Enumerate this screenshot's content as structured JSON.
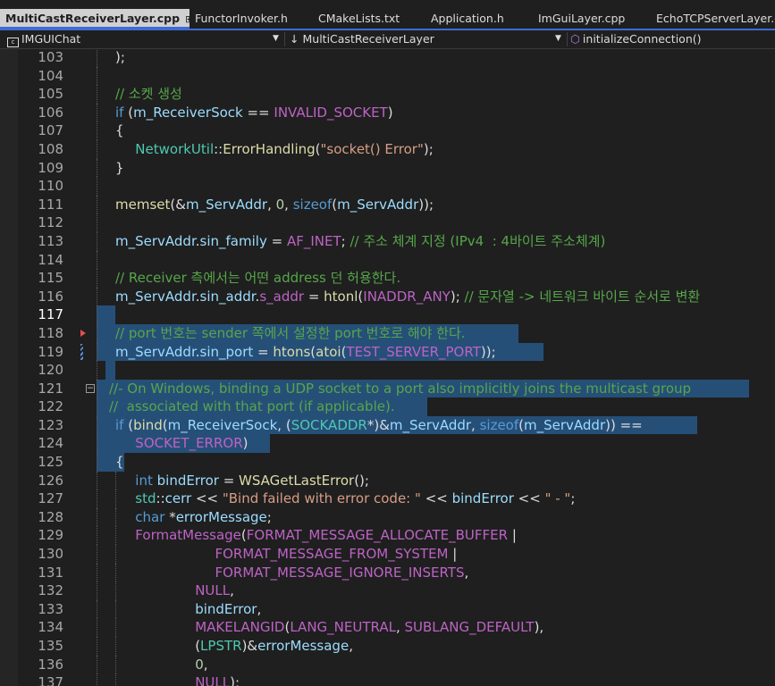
{
  "tabs": [
    {
      "label": "MultiCastReceiverLayer.cpp",
      "active": true,
      "pinned": true,
      "closable": true
    },
    {
      "label": "FunctorInvoker.h"
    },
    {
      "label": "CMakeLists.txt"
    },
    {
      "label": "Application.h"
    },
    {
      "label": "ImGuiLayer.cpp"
    },
    {
      "label": "EchoTCPServerLayer.cpp"
    }
  ],
  "navbar": {
    "project": "IMGUIChat",
    "scope": "MultiCastReceiverLayer",
    "member": "initializeConnection()"
  },
  "colors": {
    "background": "#1f1f1f",
    "selection": "#264f78",
    "keyword": "#569cd6",
    "comment": "#57a64a",
    "string": "#d69d85",
    "type": "#4ec9b0",
    "macro": "#bd63c5",
    "function": "#dcdcaa",
    "number": "#b5cea8",
    "active_tab": "#d0d0d0",
    "tab_accent": "#3e6bd6"
  },
  "editor": {
    "current_line": 117,
    "lines": [
      {
        "n": "103",
        "ind": 0,
        "toks": [
          [
            "pl",
            ");"
          ]
        ]
      },
      {
        "n": "104",
        "ind": 0,
        "toks": []
      },
      {
        "n": "105",
        "ind": 0,
        "toks": [
          [
            "cm",
            "// 소켓 생성"
          ]
        ]
      },
      {
        "n": "106",
        "ind": 0,
        "toks": [
          [
            "kw",
            "if"
          ],
          [
            "pl",
            " ("
          ],
          [
            "var",
            "m_ReceiverSock"
          ],
          [
            "pl",
            " == "
          ],
          [
            "mac",
            "INVALID_SOCKET"
          ],
          [
            "pl",
            ")"
          ]
        ]
      },
      {
        "n": "107",
        "ind": 0,
        "toks": [
          [
            "pl",
            "{"
          ]
        ]
      },
      {
        "n": "108",
        "ind": 1,
        "toks": [
          [
            "ty",
            "NetworkUtil"
          ],
          [
            "pl",
            "::"
          ],
          [
            "fn",
            "ErrorHandling"
          ],
          [
            "pl",
            "("
          ],
          [
            "str",
            "\"socket() Error\""
          ],
          [
            "pl",
            ");"
          ]
        ]
      },
      {
        "n": "109",
        "ind": 0,
        "toks": [
          [
            "pl",
            "}"
          ]
        ]
      },
      {
        "n": "110",
        "ind": 0,
        "toks": []
      },
      {
        "n": "111",
        "ind": 0,
        "toks": [
          [
            "fn",
            "memset"
          ],
          [
            "pl",
            "(&"
          ],
          [
            "var",
            "m_ServAddr"
          ],
          [
            "pl",
            ", "
          ],
          [
            "num",
            "0"
          ],
          [
            "pl",
            ", "
          ],
          [
            "kw",
            "sizeof"
          ],
          [
            "pl",
            "("
          ],
          [
            "var",
            "m_ServAddr"
          ],
          [
            "pl",
            "));"
          ]
        ]
      },
      {
        "n": "112",
        "ind": 0,
        "toks": []
      },
      {
        "n": "113",
        "ind": 0,
        "toks": [
          [
            "var",
            "m_ServAddr"
          ],
          [
            "pl",
            "."
          ],
          [
            "var",
            "sin_family"
          ],
          [
            "pl",
            " = "
          ],
          [
            "mac",
            "AF_INET"
          ],
          [
            "pl",
            "; "
          ],
          [
            "cm",
            "// 주소 체계 지정 (IPv4  : 4바이트 주소체계)"
          ]
        ]
      },
      {
        "n": "114",
        "ind": 0,
        "toks": []
      },
      {
        "n": "115",
        "ind": 0,
        "toks": [
          [
            "cm",
            "// Receiver 측에서는 어떤 address 던 허용한다."
          ]
        ]
      },
      {
        "n": "116",
        "ind": 0,
        "toks": [
          [
            "var",
            "m_ServAddr"
          ],
          [
            "pl",
            "."
          ],
          [
            "var",
            "sin_addr"
          ],
          [
            "pl",
            "."
          ],
          [
            "mac",
            "s_addr"
          ],
          [
            "pl",
            " = "
          ],
          [
            "fn",
            "htonl"
          ],
          [
            "pl",
            "("
          ],
          [
            "mac",
            "INADDR_ANY"
          ],
          [
            "pl",
            "); "
          ],
          [
            "cm",
            "// 문자열 -> 네트워크 바이트 순서로 변환"
          ]
        ]
      },
      {
        "n": "117",
        "ind": 0,
        "toks": []
      },
      {
        "n": "118",
        "ind": 0,
        "toks": [
          [
            "cm",
            "// port 번호는 sender 쪽에서 설정한 port 번호로 해야 한다."
          ]
        ]
      },
      {
        "n": "119",
        "ind": 0,
        "toks": [
          [
            "var",
            "m_ServAddr"
          ],
          [
            "pl",
            "."
          ],
          [
            "var",
            "sin_port"
          ],
          [
            "pl",
            " = "
          ],
          [
            "fn",
            "htons"
          ],
          [
            "pl",
            "("
          ],
          [
            "fn",
            "atoi"
          ],
          [
            "pl",
            "("
          ],
          [
            "mac",
            "TEST_SERVER_PORT"
          ],
          [
            "pl",
            "));"
          ]
        ]
      },
      {
        "n": "120",
        "ind": 0,
        "toks": []
      },
      {
        "n": "121",
        "ind": 0,
        "toks": [
          [
            "cm",
            "//- On Windows, binding a UDP socket to a port also implicitly joins the multicast group"
          ]
        ]
      },
      {
        "n": "122",
        "ind": 0,
        "toks": [
          [
            "cm",
            "//  associated with that port (if applicable)."
          ]
        ]
      },
      {
        "n": "123",
        "ind": 0,
        "toks": [
          [
            "kw",
            "if"
          ],
          [
            "pl",
            " ("
          ],
          [
            "fn",
            "bind"
          ],
          [
            "pl",
            "("
          ],
          [
            "var",
            "m_ReceiverSock"
          ],
          [
            "pl",
            ", ("
          ],
          [
            "ty",
            "SOCKADDR"
          ],
          [
            "pl",
            "*)&"
          ],
          [
            "var",
            "m_ServAddr"
          ],
          [
            "pl",
            ", "
          ],
          [
            "kw",
            "sizeof"
          ],
          [
            "pl",
            "("
          ],
          [
            "var",
            "m_ServAddr"
          ],
          [
            "pl",
            ")) =="
          ]
        ]
      },
      {
        "n": "124",
        "ind": 1,
        "toks": [
          [
            "mac",
            "SOCKET_ERROR"
          ],
          [
            "pl",
            ")"
          ]
        ]
      },
      {
        "n": "125",
        "ind": 0,
        "toks": [
          [
            "pl",
            "{"
          ]
        ]
      },
      {
        "n": "126",
        "ind": 1,
        "toks": [
          [
            "kw",
            "int"
          ],
          [
            "pl",
            " "
          ],
          [
            "var",
            "bindError"
          ],
          [
            "pl",
            " = "
          ],
          [
            "fn",
            "WSAGetLastError"
          ],
          [
            "pl",
            "();"
          ]
        ]
      },
      {
        "n": "127",
        "ind": 1,
        "toks": [
          [
            "ty",
            "std"
          ],
          [
            "pl",
            "::"
          ],
          [
            "var",
            "cerr"
          ],
          [
            "pl",
            " << "
          ],
          [
            "str",
            "\"Bind failed with error code: \""
          ],
          [
            "pl",
            " << "
          ],
          [
            "var",
            "bindError"
          ],
          [
            "pl",
            " << "
          ],
          [
            "str",
            "\" - \""
          ],
          [
            "pl",
            ";"
          ]
        ]
      },
      {
        "n": "128",
        "ind": 1,
        "toks": [
          [
            "kw",
            "char"
          ],
          [
            "pl",
            " *"
          ],
          [
            "var",
            "errorMessage"
          ],
          [
            "pl",
            ";"
          ]
        ]
      },
      {
        "n": "129",
        "ind": 1,
        "toks": [
          [
            "mac",
            "FormatMessage"
          ],
          [
            "pl",
            "("
          ],
          [
            "mac",
            "FORMAT_MESSAGE_ALLOCATE_BUFFER"
          ],
          [
            "pl",
            " |"
          ]
        ]
      },
      {
        "n": "130",
        "ind": 5,
        "toks": [
          [
            "mac",
            "FORMAT_MESSAGE_FROM_SYSTEM"
          ],
          [
            "pl",
            " |"
          ]
        ]
      },
      {
        "n": "131",
        "ind": 5,
        "toks": [
          [
            "mac",
            "FORMAT_MESSAGE_IGNORE_INSERTS"
          ],
          [
            "pl",
            ","
          ]
        ]
      },
      {
        "n": "132",
        "ind": 4,
        "toks": [
          [
            "mac",
            "NULL"
          ],
          [
            "pl",
            ","
          ]
        ]
      },
      {
        "n": "133",
        "ind": 4,
        "toks": [
          [
            "var",
            "bindError"
          ],
          [
            "pl",
            ","
          ]
        ]
      },
      {
        "n": "134",
        "ind": 4,
        "toks": [
          [
            "mac",
            "MAKELANGID"
          ],
          [
            "pl",
            "("
          ],
          [
            "mac",
            "LANG_NEUTRAL"
          ],
          [
            "pl",
            ", "
          ],
          [
            "mac",
            "SUBLANG_DEFAULT"
          ],
          [
            "pl",
            "),"
          ]
        ]
      },
      {
        "n": "135",
        "ind": 4,
        "toks": [
          [
            "pl",
            "("
          ],
          [
            "ty",
            "LPSTR"
          ],
          [
            "pl",
            ")&"
          ],
          [
            "var",
            "errorMessage"
          ],
          [
            "pl",
            ","
          ]
        ]
      },
      {
        "n": "136",
        "ind": 4,
        "toks": [
          [
            "num",
            "0"
          ],
          [
            "pl",
            ","
          ]
        ]
      },
      {
        "n": "137",
        "ind": 4,
        "toks": [
          [
            "mac",
            "NULL"
          ],
          [
            "pl",
            ");"
          ]
        ]
      }
    ]
  }
}
